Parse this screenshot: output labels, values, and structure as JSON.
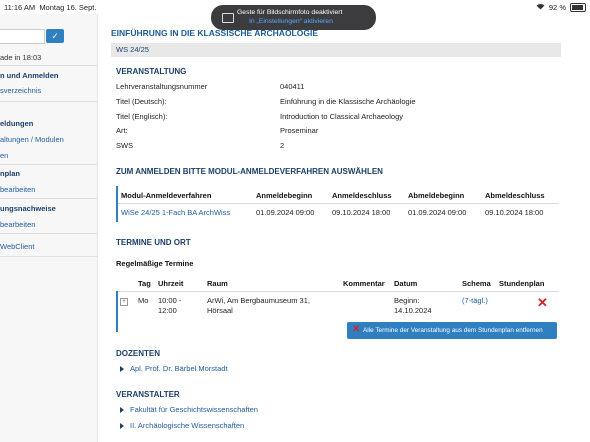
{
  "status": {
    "time": "11:16 AM",
    "date": "Montag 16. Sept.",
    "battery": "92 %"
  },
  "toast": {
    "line1": "Geste für Bildschirmfoto deaktiviert",
    "line2": "In „Einstellungen“ aktivieren"
  },
  "sidebar": {
    "items": [
      {
        "text": "ade in 18:03",
        "kind": "text"
      },
      {
        "text": "n und Anmelden",
        "kind": "head"
      },
      {
        "text": "sverzeichnis",
        "kind": "link"
      },
      {
        "text": "eldungen",
        "kind": "head"
      },
      {
        "text": "altungen / Modulen",
        "kind": "link"
      },
      {
        "text": "en",
        "kind": "link"
      },
      {
        "text": "nplan",
        "kind": "head"
      },
      {
        "text": "bearbeiten",
        "kind": "link"
      },
      {
        "text": "ungsnachweise",
        "kind": "head"
      },
      {
        "text": "bearbeiten",
        "kind": "link"
      },
      {
        "text": "WebClient",
        "kind": "link"
      }
    ]
  },
  "main": {
    "title": "EINFÜHRUNG IN DIE KLASSISCHE ARCHÄOLOGIE",
    "semester": "WS 24/25",
    "veranstaltung": {
      "heading": "VERANSTALTUNG",
      "rows": [
        {
          "label": "Lehrveranstaltungsnummer",
          "value": "040411"
        },
        {
          "label": "Titel (Deutsch):",
          "value": "Einführung in die Klassische Archäologie"
        },
        {
          "label": "Titel (Englisch):",
          "value": "Introduction to Classical Archaeology"
        },
        {
          "label": "Art:",
          "value": "Proseminar"
        },
        {
          "label": "SWS",
          "value": "2"
        }
      ]
    },
    "anmelden": {
      "heading": "ZUM ANMELDEN BITTE MODUL-ANMELDEVERFAHREN AUSWÄHLEN",
      "columns": [
        "Modul-Anmeldeverfahren",
        "Anmeldebeginn",
        "Anmeldeschluss",
        "Abmeldebeginn",
        "Abmeldeschluss"
      ],
      "row": [
        "WiSe 24/25 1-Fach BA ArchWiss",
        "01.09.2024 09:00",
        "09.10.2024 18:00",
        "01.09.2024 09:00",
        "09.10.2024 18:00"
      ]
    },
    "termine": {
      "heading": "TERMINE UND ORT",
      "subheading": "Regelmäßige Termine",
      "columns": [
        "Tag",
        "Uhrzeit",
        "Raum",
        "Kommentar",
        "Datum",
        "Schema",
        "Stundenplan"
      ],
      "row": {
        "tag": "Mo",
        "zeit1": "10:00 -",
        "zeit2": "12:00",
        "raum1": "ArWi, Am Bergbaumuseum 31,",
        "raum2": "Hörsaal",
        "datum1": "Beginn:",
        "datum2": "14.10.2024",
        "schema": "(7-tägl.)"
      },
      "remove_button": "Alle Termine der Veranstaltung aus dem Stundenplan entfernen"
    },
    "dozenten": {
      "heading": "DOZENTEN",
      "items": [
        "Apl. Prof. Dr. Bärbel Morstadt"
      ]
    },
    "veranstalter": {
      "heading": "VERANSTALTER",
      "items": [
        "Fakultät für Geschichtswissenschaften",
        "II. Archäologische Wissenschaften"
      ]
    }
  }
}
